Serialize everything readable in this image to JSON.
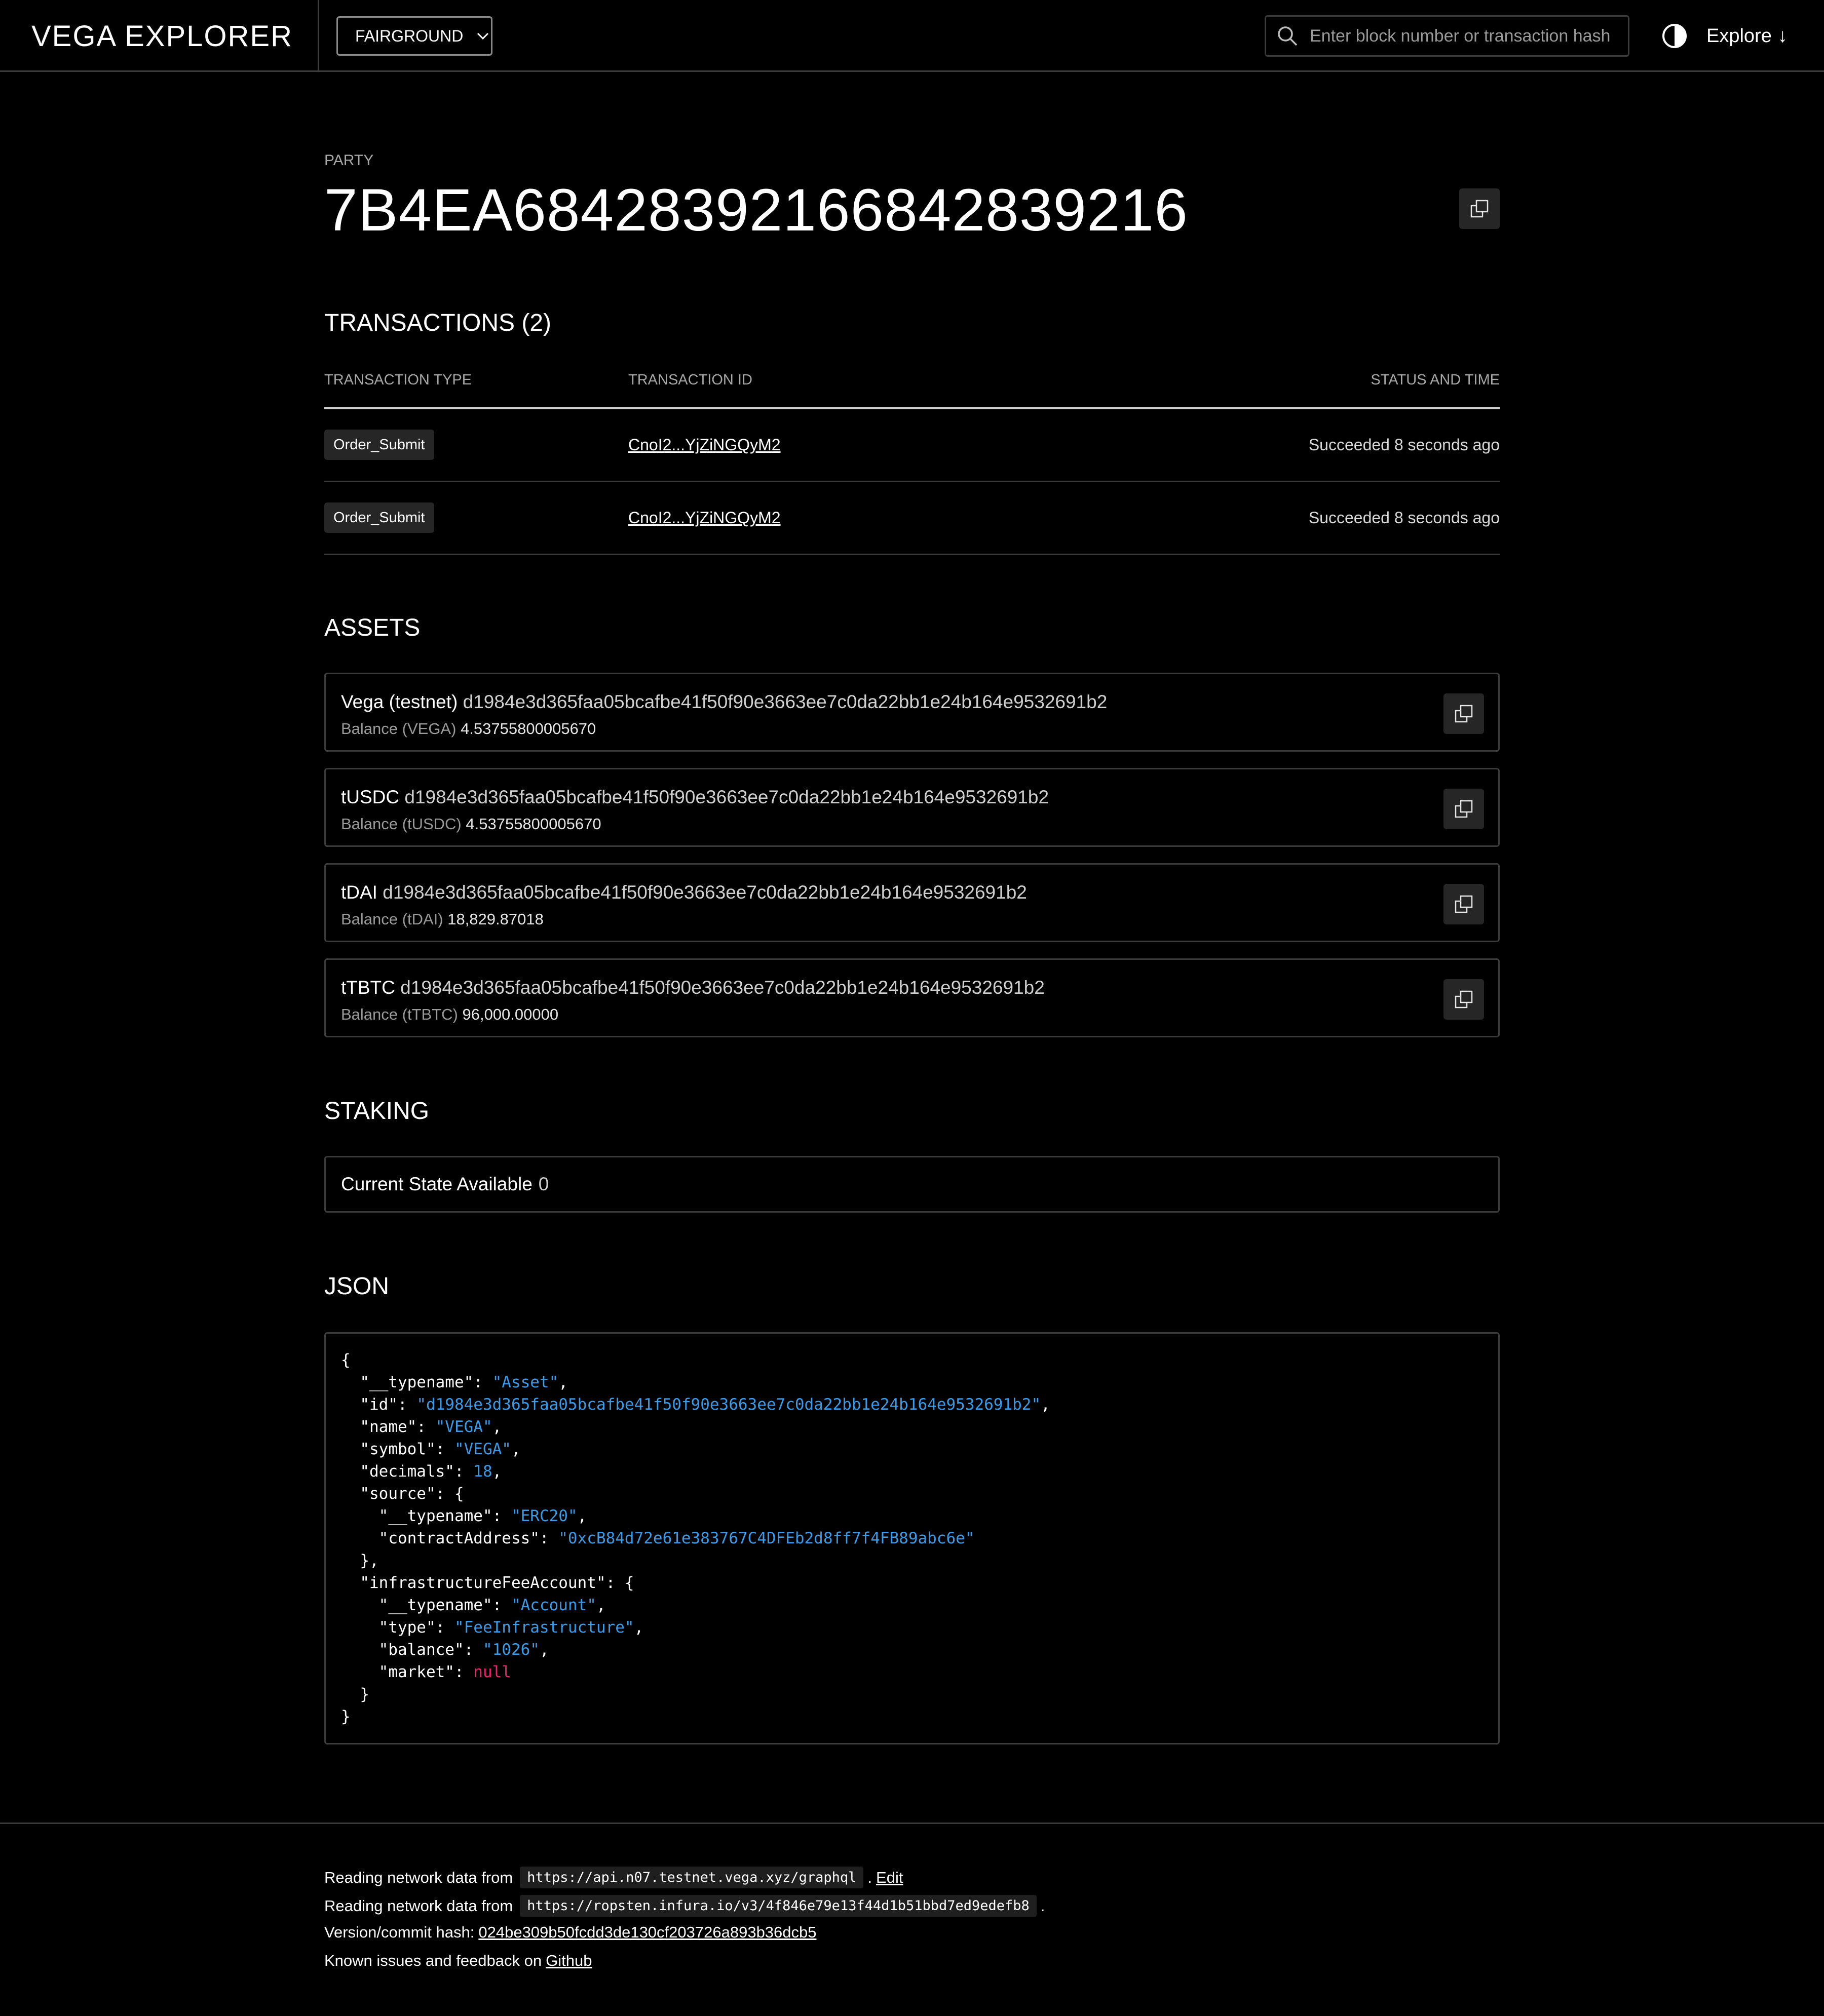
{
  "header": {
    "brand": "VEGA EXPLORER",
    "network": "FAIRGROUND",
    "search_placeholder": "Enter block number or transaction hash",
    "explore_label": "Explore",
    "explore_arrow": "↓"
  },
  "party": {
    "eyebrow": "PARTY",
    "id": "7B4EA68428392166842839216"
  },
  "transactions": {
    "title": "TRANSACTIONS (2)",
    "columns": [
      "TRANSACTION TYPE",
      "TRANSACTION ID",
      "STATUS AND TIME"
    ],
    "rows": [
      {
        "type": "Order_Submit",
        "id": "CnoI2...YjZiNGQyM2",
        "status": "Succeeded 8 seconds ago"
      },
      {
        "type": "Order_Submit",
        "id": "CnoI2...YjZiNGQyM2",
        "status": "Succeeded 8 seconds ago"
      }
    ]
  },
  "assets": {
    "title": "ASSETS",
    "items": [
      {
        "name": "Vega (testnet)",
        "hash": "d1984e3d365faa05bcafbe41f50f90e3663ee7c0da22bb1e24b164e9532691b2",
        "balance_label": "Balance (VEGA)",
        "balance": "4.53755800005670"
      },
      {
        "name": "tUSDC",
        "hash": "d1984e3d365faa05bcafbe41f50f90e3663ee7c0da22bb1e24b164e9532691b2",
        "balance_label": "Balance (tUSDC)",
        "balance": "4.53755800005670"
      },
      {
        "name": "tDAI",
        "hash": "d1984e3d365faa05bcafbe41f50f90e3663ee7c0da22bb1e24b164e9532691b2",
        "balance_label": "Balance (tDAI)",
        "balance": "18,829.87018"
      },
      {
        "name": "tTBTC",
        "hash": "d1984e3d365faa05bcafbe41f50f90e3663ee7c0da22bb1e24b164e9532691b2",
        "balance_label": "Balance (tTBTC)",
        "balance": "96,000.00000"
      }
    ]
  },
  "staking": {
    "title": "STAKING",
    "label": "Current State Available",
    "value": "0"
  },
  "json": {
    "title": "JSON",
    "lines": [
      [
        [
          "p",
          "{"
        ]
      ],
      [
        [
          "p",
          "  \"__typename\": "
        ],
        [
          "s",
          "\"Asset\""
        ],
        [
          "p",
          ","
        ]
      ],
      [
        [
          "p",
          "  \"id\": "
        ],
        [
          "s",
          "\"d1984e3d365faa05bcafbe41f50f90e3663ee7c0da22bb1e24b164e9532691b2\""
        ],
        [
          "p",
          ","
        ]
      ],
      [
        [
          "p",
          "  \"name\": "
        ],
        [
          "s",
          "\"VEGA\""
        ],
        [
          "p",
          ","
        ]
      ],
      [
        [
          "p",
          "  \"symbol\": "
        ],
        [
          "s",
          "\"VEGA\""
        ],
        [
          "p",
          ","
        ]
      ],
      [
        [
          "p",
          "  \"decimals\": "
        ],
        [
          "n",
          "18"
        ],
        [
          "p",
          ","
        ]
      ],
      [
        [
          "p",
          "  \"source\": {"
        ]
      ],
      [
        [
          "p",
          "    \"__typename\": "
        ],
        [
          "s",
          "\"ERC20\""
        ],
        [
          "p",
          ","
        ]
      ],
      [
        [
          "p",
          "    \"contractAddress\": "
        ],
        [
          "s",
          "\"0xcB84d72e61e383767C4DFEb2d8ff7f4FB89abc6e\""
        ]
      ],
      [
        [
          "p",
          "  },"
        ]
      ],
      [
        [
          "p",
          "  \"infrastructureFeeAccount\": {"
        ]
      ],
      [
        [
          "p",
          "    \"__typename\": "
        ],
        [
          "s",
          "\"Account\""
        ],
        [
          "p",
          ","
        ]
      ],
      [
        [
          "p",
          "    \"type\": "
        ],
        [
          "s",
          "\"FeeInfrastructure\""
        ],
        [
          "p",
          ","
        ]
      ],
      [
        [
          "p",
          "    \"balance\": "
        ],
        [
          "s",
          "\"1026\""
        ],
        [
          "p",
          ","
        ]
      ],
      [
        [
          "p",
          "    \"market\": "
        ],
        [
          "x",
          "null"
        ]
      ],
      [
        [
          "p",
          "  }"
        ]
      ],
      [
        [
          "p",
          "}"
        ]
      ]
    ]
  },
  "footer": {
    "line1_prefix": "Reading network data from",
    "line1_url": "https://api.n07.testnet.vega.xyz/graphql",
    "line1_suffix": ".",
    "line1_link": "Edit",
    "line2_prefix": "Reading network data from",
    "line2_url": "https://ropsten.infura.io/v3/4f846e79e13f44d1b51bbd7ed9edefb8",
    "line2_suffix": ".",
    "line3_prefix": "Version/commit hash:",
    "line3_hash": "024be309b50fcdd3de130cf203726a893b36dcb5",
    "line4_prefix": "Known issues and feedback on",
    "line4_link": "Github"
  },
  "colors": {
    "background": "#000000",
    "json_string": "#3a9be8",
    "json_null": "#e8246c",
    "border": "#3a3a3a"
  },
  "icons": [
    "search-icon",
    "chevron-down-icon",
    "theme-toggle-icon",
    "copy-icon"
  ]
}
